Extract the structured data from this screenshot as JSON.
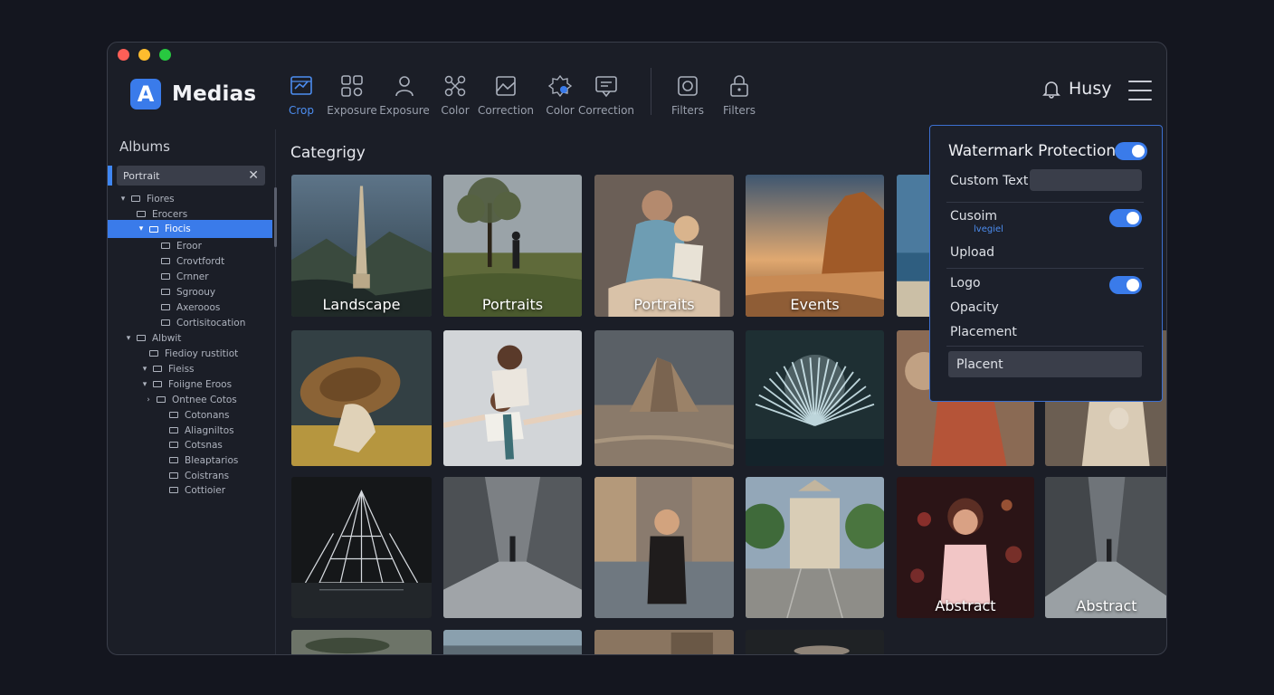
{
  "app": {
    "logo_letter": "A",
    "name": "Medias"
  },
  "toolbar": {
    "tools": [
      {
        "label": "Crop",
        "icon": "crop-icon",
        "active": true
      },
      {
        "label": "Exposure",
        "icon": "exposure-icon"
      },
      {
        "label": "Exposure",
        "icon": "exposure-person-icon"
      },
      {
        "label": "Color",
        "icon": "color-nodes-icon"
      },
      {
        "label": "Correction",
        "icon": "image-correction-icon"
      },
      {
        "label": "Color",
        "icon": "color-badge-icon"
      },
      {
        "label": "Correction",
        "icon": "message-correction-icon"
      },
      {
        "label": "Filters",
        "icon": "filter-frame-icon"
      },
      {
        "label": "Filters",
        "icon": "lock-filter-icon"
      }
    ]
  },
  "user": {
    "name": "Husy"
  },
  "sidebar": {
    "title": "Albums",
    "search_value": "Portrait",
    "tree": [
      {
        "label": "Fiores",
        "chevron": "v"
      },
      {
        "label": "Erocers",
        "chevron": ""
      },
      {
        "label": "Fiocis",
        "chevron": "v",
        "selected": true
      },
      {
        "label": "Eroor",
        "chevron": ""
      },
      {
        "label": "Crovtfordt",
        "chevron": ""
      },
      {
        "label": "Crnner",
        "chevron": ""
      },
      {
        "label": "Sgroouy",
        "chevron": ""
      },
      {
        "label": "Axerooos",
        "chevron": ""
      },
      {
        "label": "Cortisitocation",
        "chevron": ""
      },
      {
        "label": "Albwit",
        "chevron": "v"
      },
      {
        "label": "Fiedioy rustitiot",
        "chevron": ""
      },
      {
        "label": "Fieiss",
        "chevron": "v"
      },
      {
        "label": "Foiigne Eroos",
        "chevron": "v"
      },
      {
        "label": "Ontnee Cotos",
        "chevron": ">"
      },
      {
        "label": "Cotonans",
        "chevron": ""
      },
      {
        "label": "Aliagniltos",
        "chevron": ""
      },
      {
        "label": "Cotsnas",
        "chevron": ""
      },
      {
        "label": "Bleaptarios",
        "chevron": ""
      },
      {
        "label": "Coistrans",
        "chevron": ""
      },
      {
        "label": "Cottioier",
        "chevron": ""
      }
    ]
  },
  "main": {
    "title": "Categrigy",
    "tiles": [
      {
        "label": "Landscape",
        "scene": "tower"
      },
      {
        "label": "Portraits",
        "scene": "tree"
      },
      {
        "label": "Portraits",
        "scene": "family"
      },
      {
        "label": "Events",
        "scene": "cliff"
      },
      {
        "label": "",
        "scene": "sea"
      },
      {
        "label": "",
        "scene": "lion"
      },
      {
        "label": "",
        "scene": "kids"
      },
      {
        "label": "",
        "scene": "rock"
      },
      {
        "label": "",
        "scene": "splash"
      },
      {
        "label": "",
        "scene": "dress"
      },
      {
        "label": "",
        "scene": "dress2"
      },
      {
        "label": "",
        "scene": "pyramid"
      },
      {
        "label": "",
        "scene": "street"
      },
      {
        "label": "",
        "scene": "woman"
      },
      {
        "label": "",
        "scene": "plaza"
      },
      {
        "label": "Abstract",
        "scene": "bokeh"
      },
      {
        "label": "Abstract",
        "scene": "street2"
      },
      {
        "label": "",
        "scene": "partial1"
      },
      {
        "label": "",
        "scene": "partial2"
      },
      {
        "label": "",
        "scene": "partial3"
      },
      {
        "label": "",
        "scene": "partial4"
      }
    ]
  },
  "watermark": {
    "title": "Watermark Protection",
    "enabled": true,
    "custom_text_label": "Custom Text",
    "custom_text_value": "",
    "custom_label": "Cusoim",
    "custom_sublabel": "lvegiel",
    "custom_enabled": true,
    "upload_label": "Upload",
    "logo_label": "Logo",
    "logo_enabled": true,
    "opacity_label": "Opacity",
    "placement_label": "Placement",
    "placement_value": "Placent"
  },
  "colors": {
    "accent": "#3a7bea",
    "window_bg": "#1b1e27",
    "page_bg": "#14161f"
  }
}
